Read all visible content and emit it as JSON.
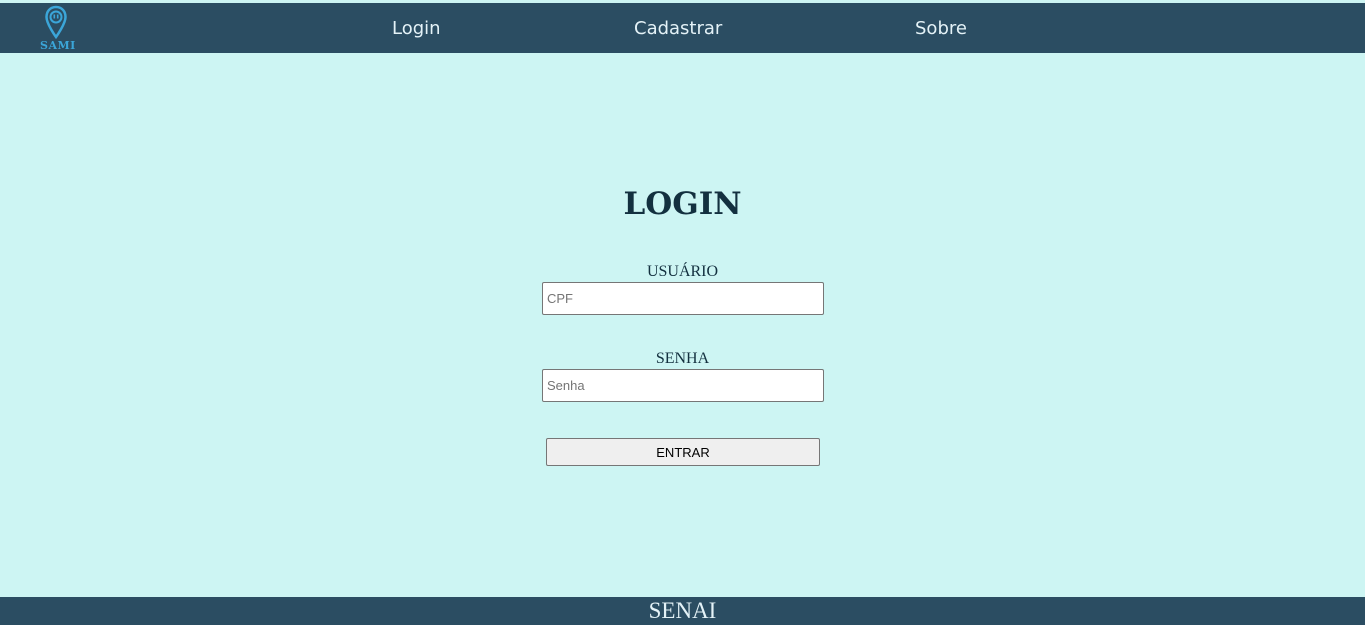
{
  "brand": {
    "logo_text": "SAMI",
    "logo_color": "#3ba6d9"
  },
  "nav": {
    "items": [
      {
        "label": "Login"
      },
      {
        "label": "Cadastrar"
      },
      {
        "label": "Sobre"
      }
    ]
  },
  "login": {
    "title": "LOGIN",
    "user_label": "USUÁRIO",
    "user_placeholder": "CPF",
    "pass_label": "SENHA",
    "pass_placeholder": "Senha",
    "submit_label": "ENTRAR"
  },
  "footer": {
    "text": "SENAI"
  },
  "colors": {
    "header_bg": "#2b4d62",
    "page_bg": "#cdf5f3",
    "title": "#13303f"
  },
  "icons": {
    "logo": "map-pin-icon"
  }
}
